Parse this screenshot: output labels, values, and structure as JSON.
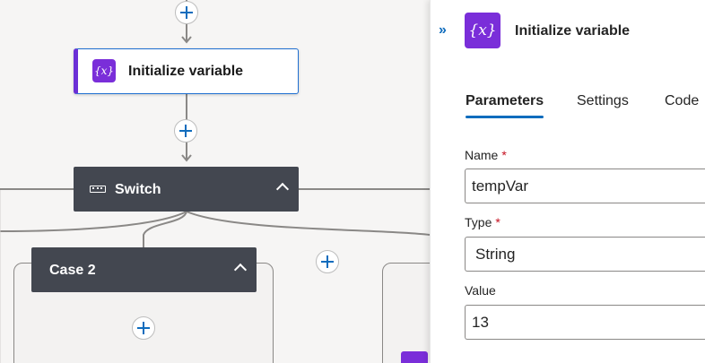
{
  "canvas": {
    "initialize_action": {
      "title": "Initialize variable",
      "icon": "variable-icon"
    },
    "switch": {
      "title": "Switch",
      "icon": "switch-icon"
    },
    "case2": {
      "title": "Case 2"
    }
  },
  "panel": {
    "title": "Initialize variable",
    "icon": "variable-icon",
    "collapse_glyph": "»",
    "tabs": [
      {
        "label": "Parameters",
        "selected": true
      },
      {
        "label": "Settings",
        "selected": false
      },
      {
        "label": "Code",
        "selected": false
      }
    ],
    "fields": {
      "name": {
        "label": "Name",
        "required_marker": "*",
        "value": "tempVar"
      },
      "type": {
        "label": "Type",
        "required_marker": "*",
        "value": "String"
      },
      "value": {
        "label": "Value",
        "value": "13"
      }
    }
  },
  "colors": {
    "accent": "#0f6cbd",
    "variable_purple": "#7a2ed9",
    "scope_header": "#434750",
    "required": "#c50f1f"
  }
}
